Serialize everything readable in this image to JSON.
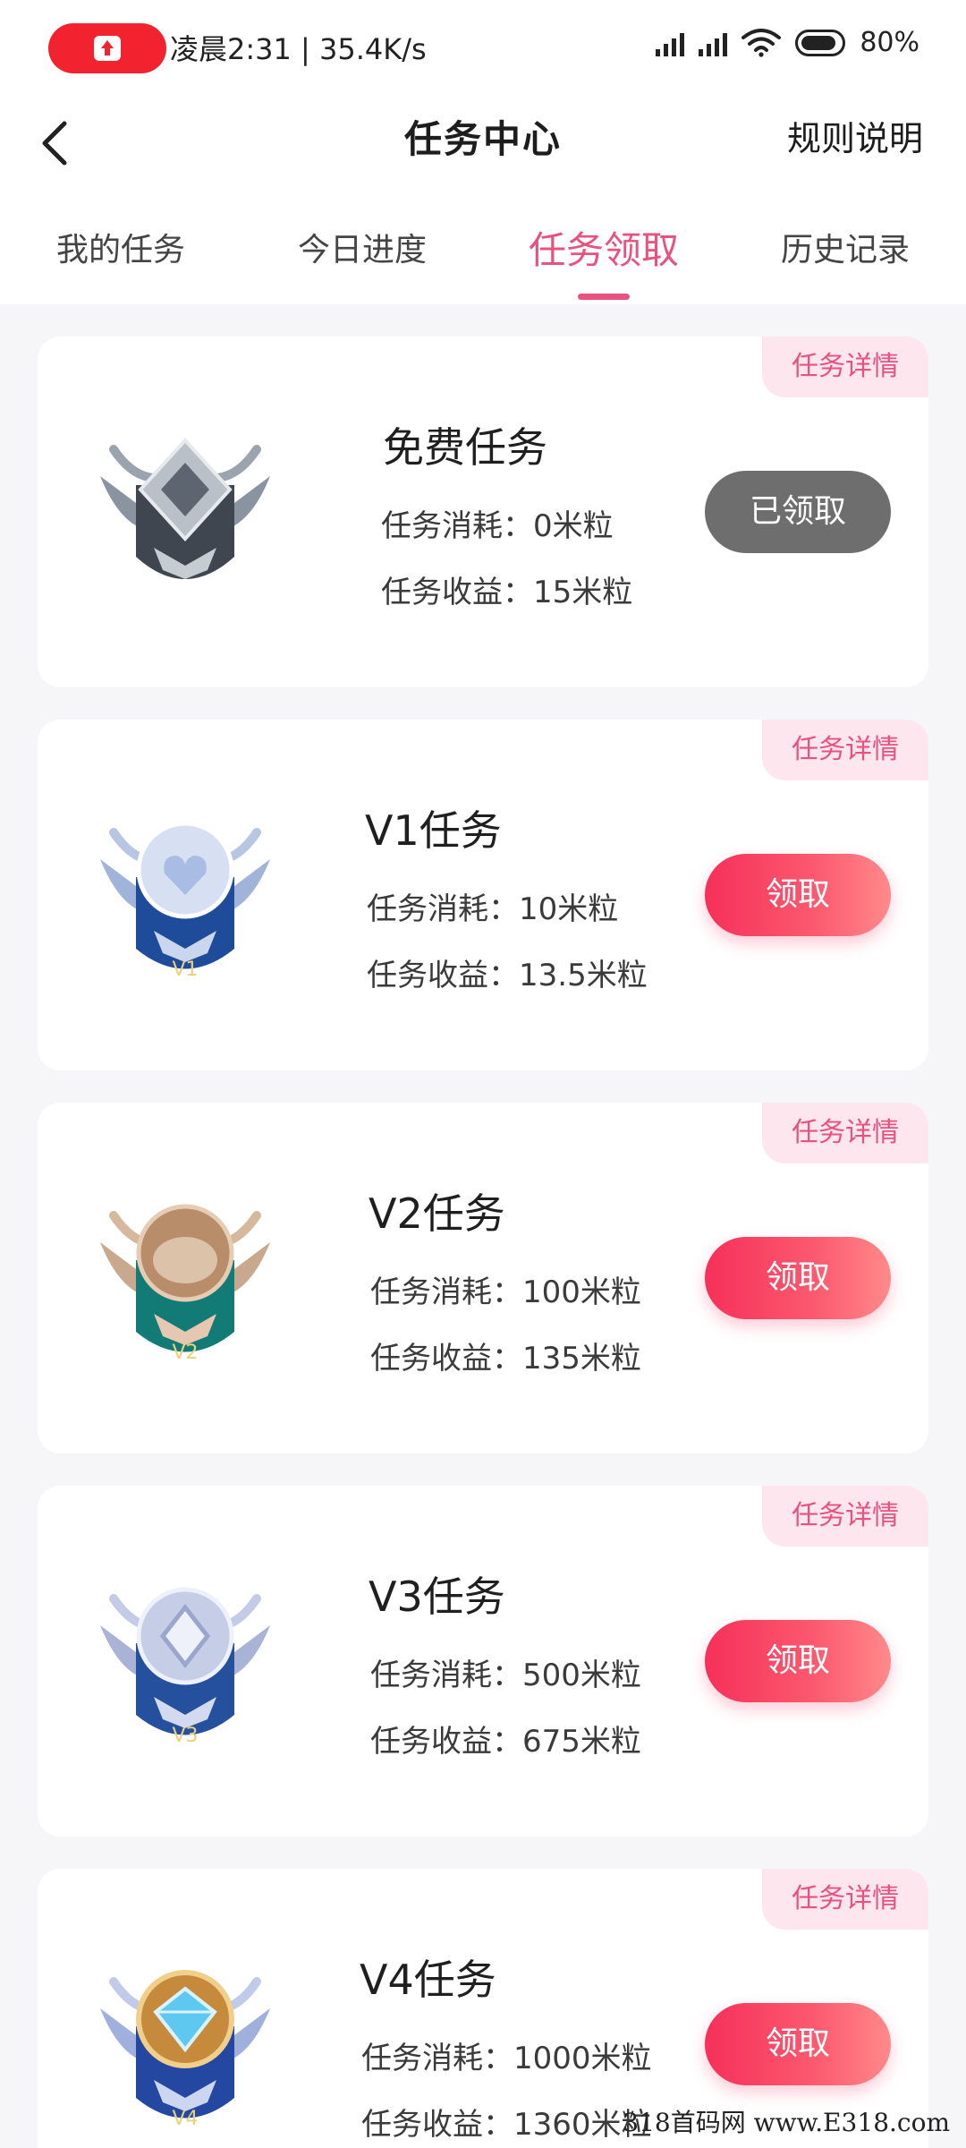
{
  "status_bar": {
    "time_speed": "凌晨2:31 | 35.4K/s",
    "battery": "80%"
  },
  "header": {
    "title": "任务中心",
    "rules_label": "规则说明"
  },
  "tabs": [
    {
      "label": "我的任务"
    },
    {
      "label": "今日进度"
    },
    {
      "label": "任务领取",
      "active": true
    },
    {
      "label": "历史记录"
    }
  ],
  "detail_tag_label": "任务详情",
  "tasks": [
    {
      "name": "免费任务",
      "cost": "任务消耗：0米粒",
      "reward": "任务收益：15米粒",
      "button": "已领取",
      "state": "claimed",
      "badge_color": "#5b6470"
    },
    {
      "name": "V1任务",
      "cost": "任务消耗：10米粒",
      "reward": "任务收益：13.5米粒",
      "button": "领取",
      "state": "available",
      "badge_color": "#2e5aa8",
      "badge_label": "V1"
    },
    {
      "name": "V2任务",
      "cost": "任务消耗：100米粒",
      "reward": "任务收益：135米粒",
      "button": "领取",
      "state": "available",
      "badge_color": "#1f8a84",
      "badge_label": "V2"
    },
    {
      "name": "V3任务",
      "cost": "任务消耗：500米粒",
      "reward": "任务收益：675米粒",
      "button": "领取",
      "state": "available",
      "badge_color": "#2e5aa8",
      "badge_label": "V3"
    },
    {
      "name": "V4任务",
      "cost": "任务消耗：1000米粒",
      "reward": "任务收益：1360米粒",
      "button": "领取",
      "state": "available",
      "badge_color": "#2a4fa8",
      "badge_label": "V4"
    }
  ],
  "watermark": "318首码网 www.E318.com"
}
